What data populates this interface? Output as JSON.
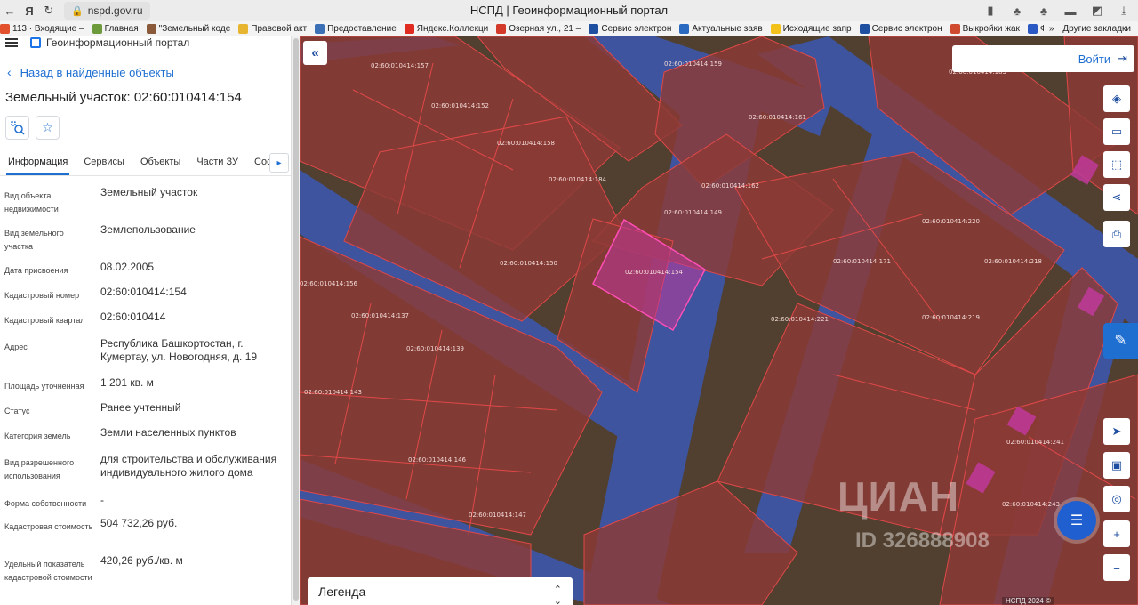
{
  "browser": {
    "url": "nspd.gov.ru",
    "window_title": "НСПД | Геоинформационный портал",
    "bookmarks": [
      {
        "label": "113 · Входящие –",
        "color": "#e3512c"
      },
      {
        "label": "Главная",
        "color": "#6d9a3a"
      },
      {
        "label": "\"Земельный коде",
        "color": "#8a5a3a"
      },
      {
        "label": "Правовой акт",
        "color": "#e8b531"
      },
      {
        "label": "Предоставление",
        "color": "#3b6fb6"
      },
      {
        "label": "Яндекс.Коллекци",
        "color": "#e02b20"
      },
      {
        "label": "Озерная ул., 21 –",
        "color": "#d33a2a"
      },
      {
        "label": "Сервис электрон",
        "color": "#1f4fa0"
      },
      {
        "label": "Актуальные заяв",
        "color": "#2a6ac0"
      },
      {
        "label": "Исходящие запр",
        "color": "#f2c21b"
      },
      {
        "label": "Сервис электрон",
        "color": "#1f4fa0"
      },
      {
        "label": "Выкройки жак",
        "color": "#d04a30"
      },
      {
        "label": "ФГИ",
        "color": "#2b59c3"
      }
    ],
    "more_bookmarks": "»",
    "other_bookmarks": "Другие закладки"
  },
  "panel": {
    "logo_text": "Геоинформационный портал",
    "back_link": "Назад в найденные объекты",
    "title": "Земельный участок: 02:60:010414:154",
    "tabs": [
      "Информация",
      "Сервисы",
      "Объекты",
      "Части ЗУ",
      "Соста"
    ],
    "active_tab": "Информация",
    "details": [
      {
        "label": "Вид объекта недвижимости",
        "value": "Земельный участок"
      },
      {
        "label": "Вид земельного участка",
        "value": "Землепользование"
      },
      {
        "label": "Дата присвоения",
        "value": "08.02.2005"
      },
      {
        "label": "Кадастровый номер",
        "value": "02:60:010414:154"
      },
      {
        "label": "Кадастровый квартал",
        "value": "02:60:010414"
      },
      {
        "label": "Адрес",
        "value": "Республика Башкортостан, г. Кумертау, ул. Новогодняя, д. 19"
      },
      {
        "label": "Площадь уточненная",
        "value": "1 201 кв. м"
      },
      {
        "label": "Статус",
        "value": "Ранее учтенный"
      },
      {
        "label": "Категория земель",
        "value": "Земли населенных пунктов"
      },
      {
        "label": "Вид разрешенного использования",
        "value": "для строительства и обслуживания индивидуального жилого дома"
      },
      {
        "label": "Форма собственности",
        "value": "-"
      },
      {
        "label": "Кадастровая стоимость",
        "value": "504 732,26 руб."
      },
      {
        "label": "Удельный показатель кадастровой стоимости",
        "value": "420,26 руб./кв. м"
      }
    ]
  },
  "map": {
    "login_label": "Войти",
    "legend_label": "Легенда",
    "watermark": "ЦИАН",
    "watermark_id": "ID 326888908",
    "copyright": "НСПД 2024 ©",
    "colors": {
      "parcel_fill": "#8c3a36",
      "parcel_border": "#e04848",
      "road_blue": "#3d56a8",
      "highlight": "#c0399a"
    },
    "parcel_labels": [
      "02:60:010414:157",
      "02:60:010414:159",
      "02:60:010414:183",
      "02:60:010414:161",
      "02:60:010414:152",
      "02:60:010414:158",
      "02:60:010414:184",
      "02:60:010414:162",
      "02:60:010414:154",
      "02:60:010414:150",
      "02:60:010414:149",
      "02:60:010414:156",
      "02:60:010414:137",
      "02:60:010414:139",
      "02:60:010414:171",
      "02:60:010414:220",
      "02:60:010414:218",
      "02:60:010414:221",
      "02:60:010414:219",
      "02:60:010414:143",
      "02:60:010414:146",
      "02:60:010414:147",
      "02:60:010414:241",
      "02:60:010414:243"
    ]
  }
}
